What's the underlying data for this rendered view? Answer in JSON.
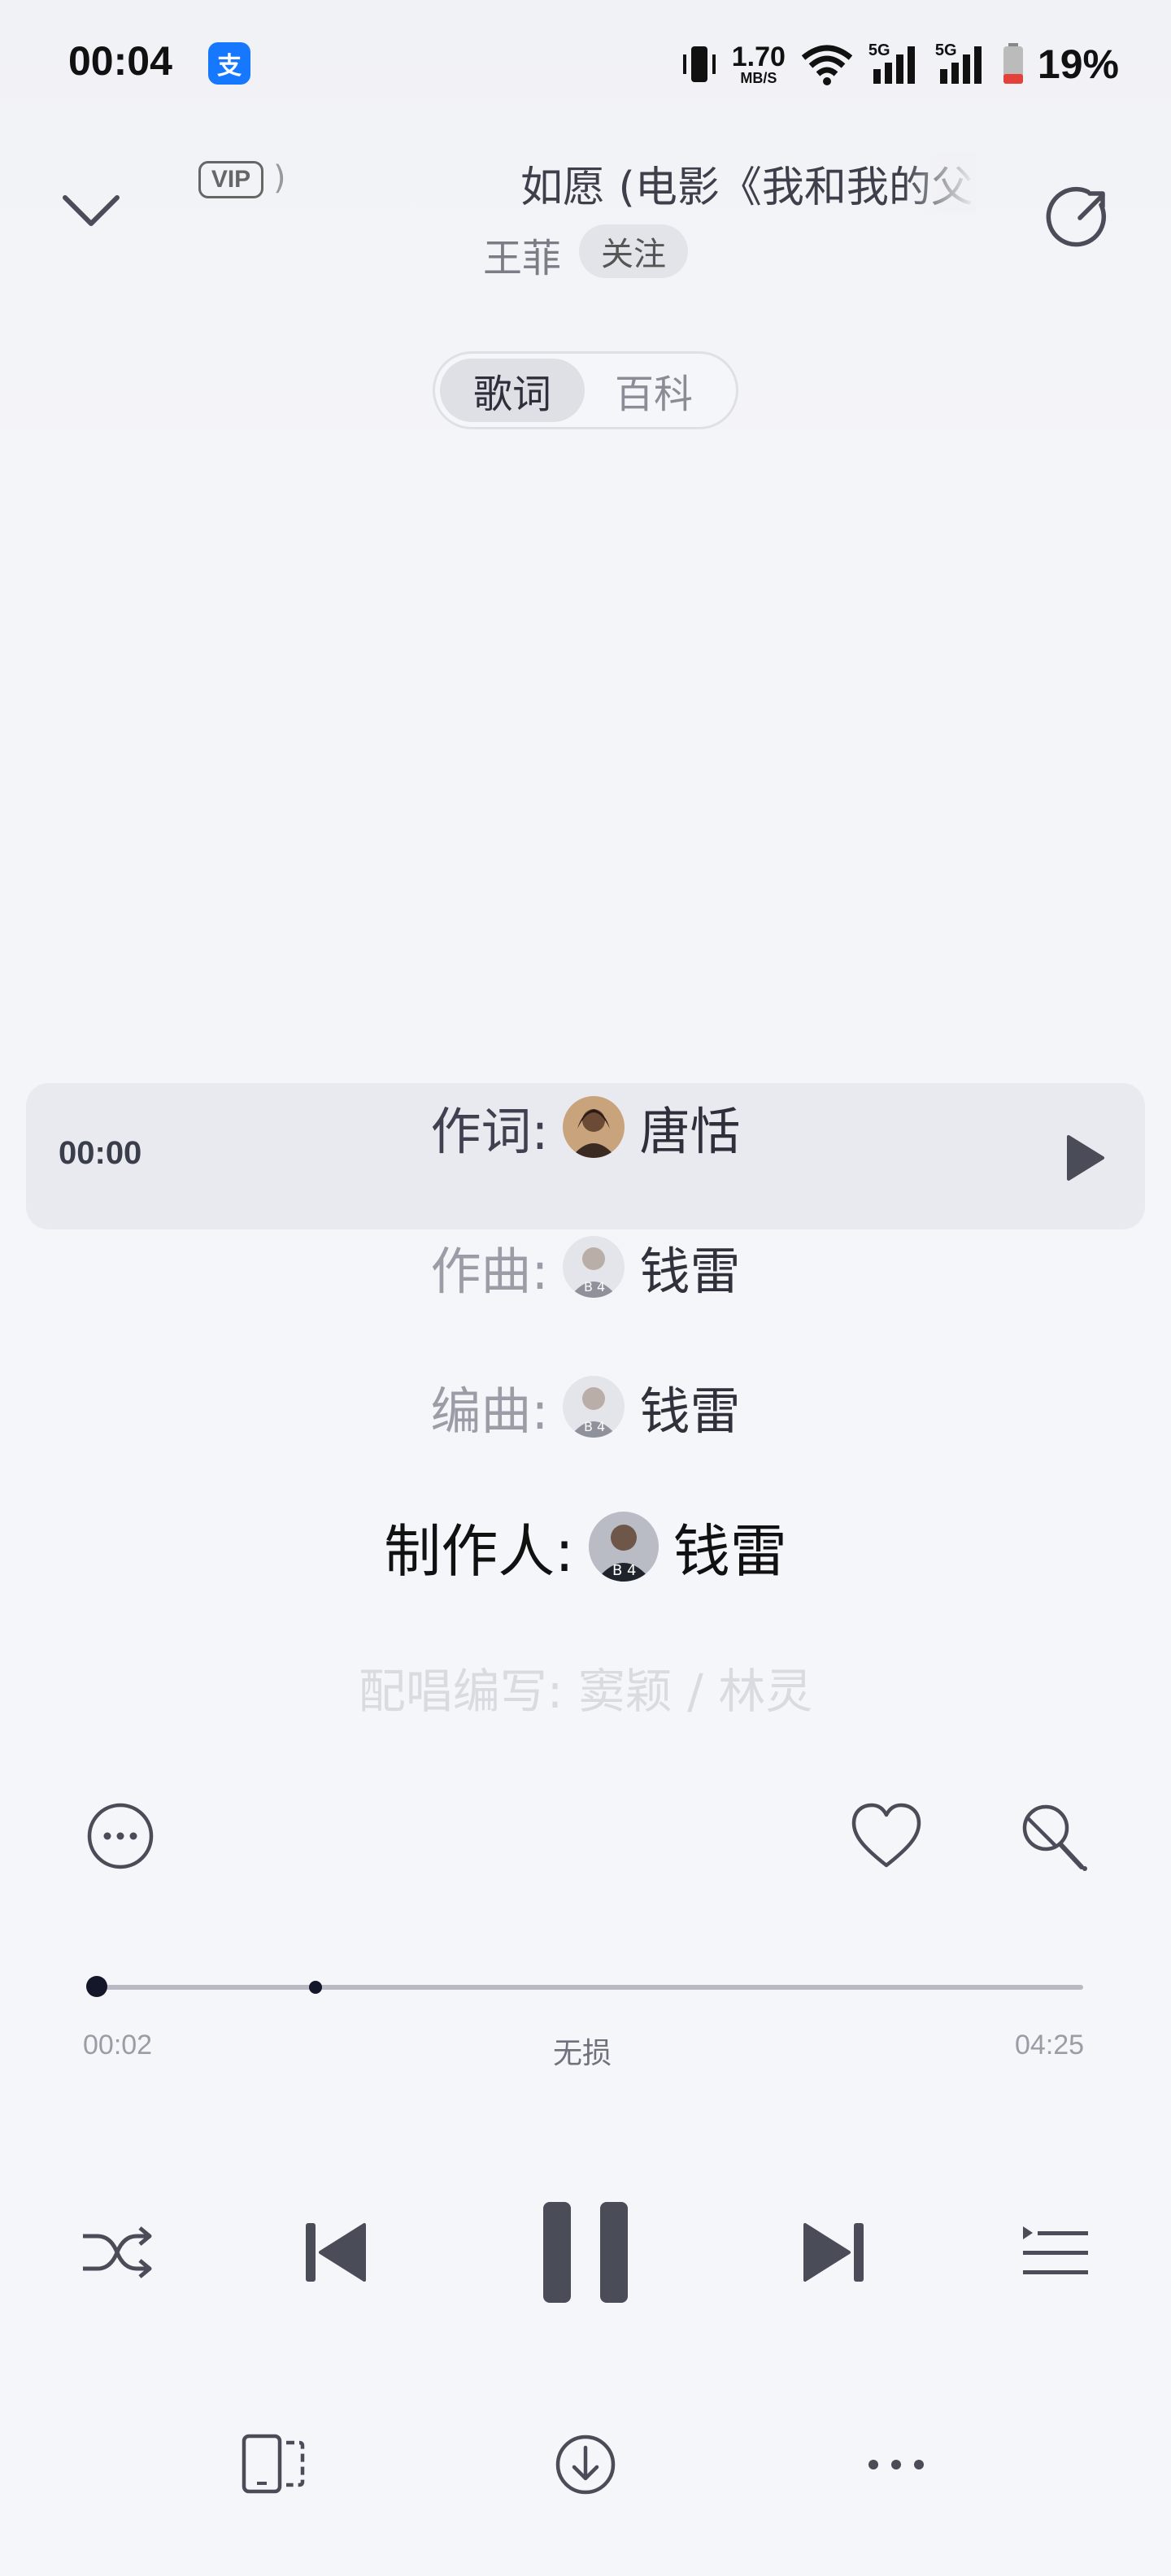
{
  "status_bar": {
    "time": "00:04",
    "app_badge": "支",
    "net_speed_value": "1.70",
    "net_speed_unit": "MB/S",
    "signal_1": "5G",
    "signal_2": "5G",
    "battery": "19%"
  },
  "header": {
    "vip_badge": "VIP",
    "vip_paren": ")",
    "title": "如愿 (电影《我和我的父辈》主题曲)",
    "artist": "王菲",
    "follow_label": "关注"
  },
  "tabs": [
    {
      "label": "歌词",
      "active": true
    },
    {
      "label": "百科",
      "active": false
    }
  ],
  "current_line_time": "00:00",
  "credits": [
    {
      "label": "作词:",
      "name": "唐恬"
    },
    {
      "label": "作曲:",
      "name": "钱雷"
    },
    {
      "label": "编曲:",
      "name": "钱雷"
    },
    {
      "label": "制作人:",
      "name": "钱雷"
    },
    {
      "label": "配唱编写: 窦颖 / 林灵",
      "name": ""
    }
  ],
  "player": {
    "current_time": "00:02",
    "quality": "无损",
    "total_time": "04:25",
    "progress_fraction": 0.008
  },
  "icons": {
    "more": "more-circle-icon",
    "favorite": "heart-icon",
    "mic": "mic-icon",
    "shuffle": "shuffle-icon",
    "prev": "previous-icon",
    "pause": "pause-icon",
    "next": "next-icon",
    "playlist": "playlist-icon",
    "device": "device-icon",
    "download": "download-icon",
    "more_dots": "more-dots-icon"
  },
  "colors": {
    "accent_dark": "#14162a",
    "alipay_blue": "#1677ff",
    "battery_low": "#e5413b"
  }
}
